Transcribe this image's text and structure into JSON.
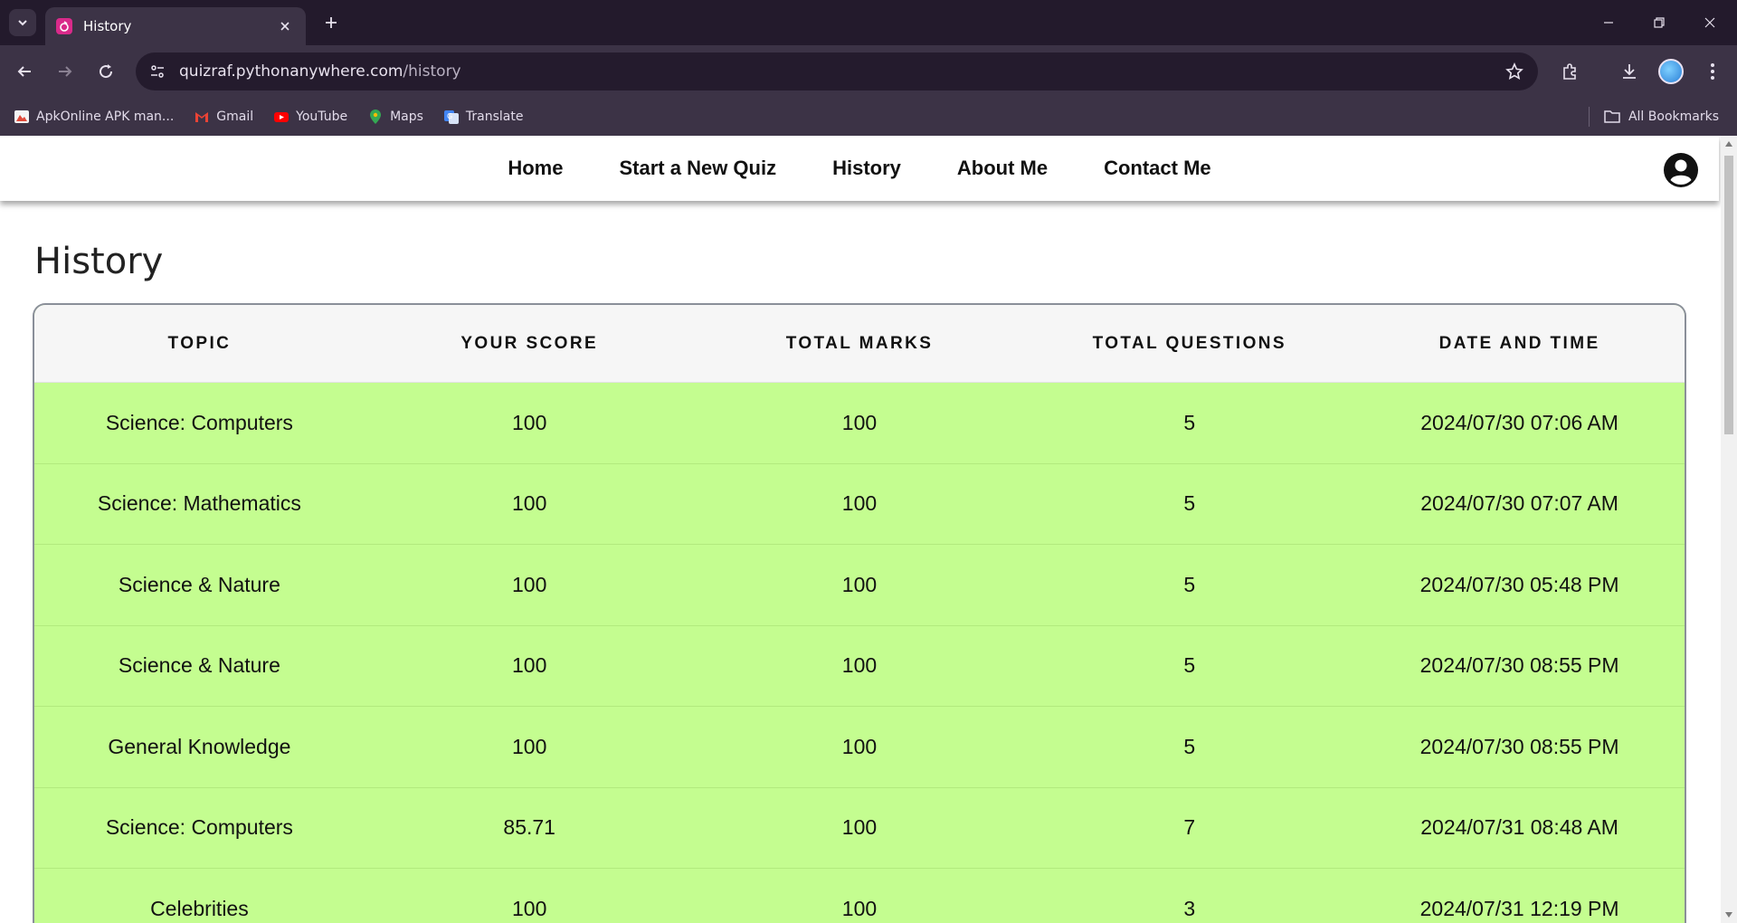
{
  "browser": {
    "tab_title": "History",
    "url_host": "quizraf.pythonanywhere.com",
    "url_path": "/history",
    "bookmarks": [
      {
        "label": "ApkOnline APK man...",
        "icon": "apkonline-icon"
      },
      {
        "label": "Gmail",
        "icon": "gmail-icon"
      },
      {
        "label": "YouTube",
        "icon": "youtube-icon"
      },
      {
        "label": "Maps",
        "icon": "maps-icon"
      },
      {
        "label": "Translate",
        "icon": "translate-icon"
      }
    ],
    "all_bookmarks_label": "All Bookmarks"
  },
  "nav": {
    "links": [
      "Home",
      "Start a New Quiz",
      "History",
      "About Me",
      "Contact Me"
    ]
  },
  "page": {
    "title": "History"
  },
  "table": {
    "headers": [
      "TOPIC",
      "YOUR SCORE",
      "TOTAL MARKS",
      "TOTAL QUESTIONS",
      "DATE AND TIME"
    ],
    "rows": [
      [
        "Science: Computers",
        "100",
        "100",
        "5",
        "2024/07/30 07:06 AM"
      ],
      [
        "Science: Mathematics",
        "100",
        "100",
        "5",
        "2024/07/30 07:07 AM"
      ],
      [
        "Science & Nature",
        "100",
        "100",
        "5",
        "2024/07/30 05:48 PM"
      ],
      [
        "Science & Nature",
        "100",
        "100",
        "5",
        "2024/07/30 08:55 PM"
      ],
      [
        "General Knowledge",
        "100",
        "100",
        "5",
        "2024/07/30 08:55 PM"
      ],
      [
        "Science: Computers",
        "85.71",
        "100",
        "7",
        "2024/07/31 08:48 AM"
      ],
      [
        "Celebrities",
        "100",
        "100",
        "3",
        "2024/07/31 12:19 PM"
      ]
    ]
  },
  "colors": {
    "row_background": "#c4fd90",
    "header_background": "#f6f6f6",
    "browser_frame": "#231a2c",
    "browser_toolbar": "#3c3346"
  }
}
